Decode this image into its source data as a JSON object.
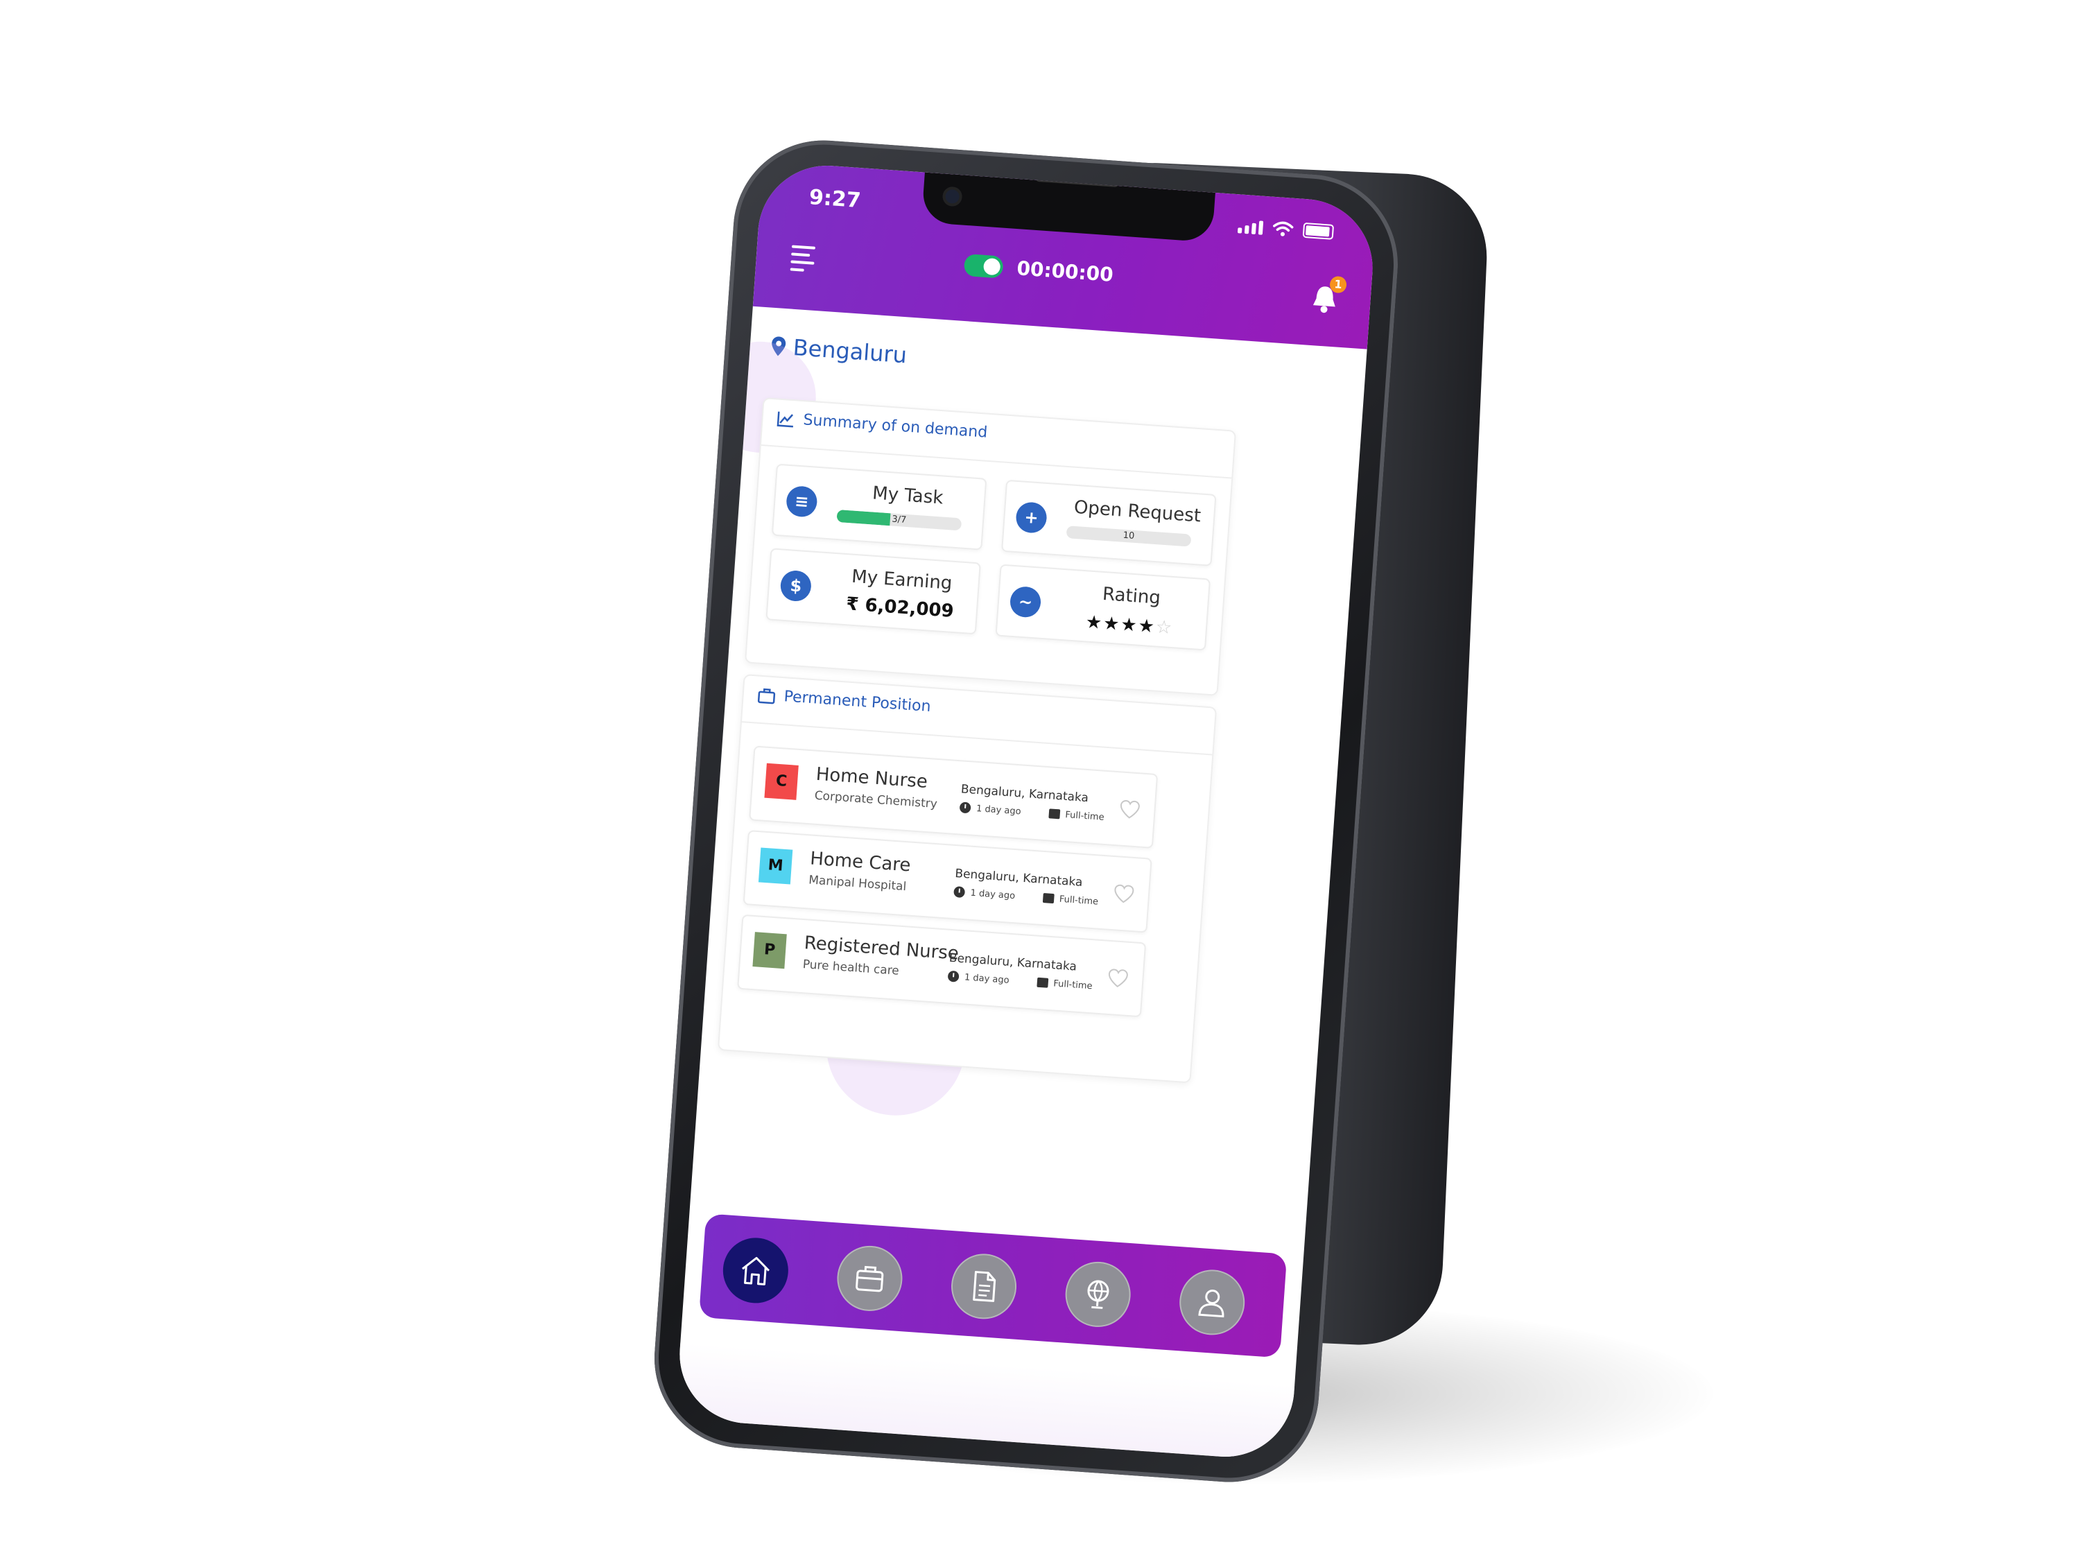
{
  "status_bar": {
    "time": "9:27"
  },
  "header": {
    "timer": "00:00:00",
    "notification_count": "1"
  },
  "location": "Bengaluru",
  "summary": {
    "title": "Summary of on demand",
    "my_task": {
      "label": "My Task",
      "progress_text": "3/7",
      "progress_fraction": 0.43
    },
    "open_request": {
      "label": "Open Request",
      "count": "10"
    },
    "my_earning": {
      "label": "My Earning",
      "value": "₹ 6,02,009"
    },
    "rating": {
      "label": "Rating",
      "filled_stars": 4,
      "max_stars": 5
    }
  },
  "permanent": {
    "title": "Permanent Position",
    "jobs": [
      {
        "logo": "C",
        "logo_color": "#f24a4a",
        "title": "Home Nurse",
        "company": "Corporate Chemistry",
        "location": "Bengaluru, Karnataka",
        "posted": "1 day ago",
        "type": "Full-time"
      },
      {
        "logo": "M",
        "logo_color": "#52d3f0",
        "title": "Home Care",
        "company": "Manipal Hospital",
        "location": "Bengaluru, Karnataka",
        "posted": "1 day ago",
        "type": "Full-time"
      },
      {
        "logo": "P",
        "logo_color": "#7d9b68",
        "title": "Registered Nurse",
        "company": "Pure health care",
        "location": "Bengaluru, Karnataka",
        "posted": "1 day ago",
        "type": "Full-time"
      }
    ]
  },
  "nav": [
    "home-icon",
    "briefcase-icon",
    "document-icon",
    "globe-icon",
    "user-icon"
  ],
  "colors": {
    "header": "#8a1fc0",
    "accent_blue": "#2a5cb8",
    "toggle_on": "#19b36b",
    "nav_active": "#15136e",
    "badge": "#f7931e"
  }
}
